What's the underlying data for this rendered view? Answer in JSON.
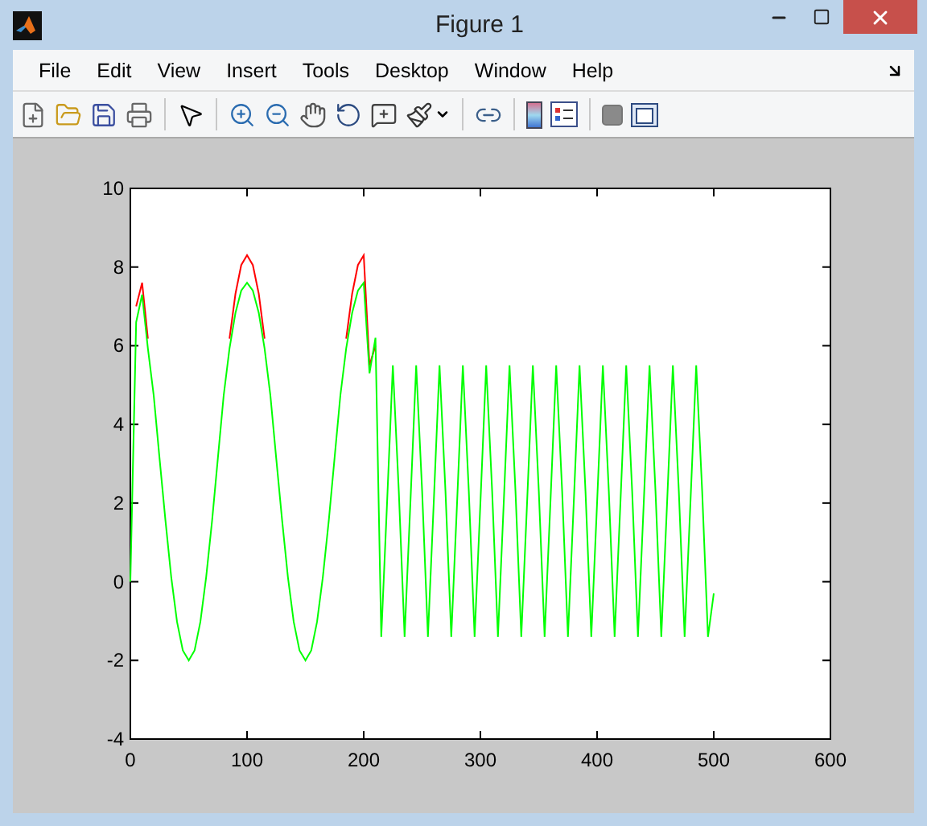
{
  "window": {
    "title": "Figure 1"
  },
  "menu": [
    "File",
    "Edit",
    "View",
    "Insert",
    "Tools",
    "Desktop",
    "Window",
    "Help"
  ],
  "axes": {
    "chart_data": {
      "type": "line",
      "xlim": [
        0,
        600
      ],
      "ylim": [
        -4,
        10
      ],
      "xticks": [
        0,
        100,
        200,
        300,
        400,
        500,
        600
      ],
      "yticks": [
        -4,
        -2,
        0,
        2,
        4,
        6,
        8,
        10
      ],
      "x": [
        0,
        5,
        10,
        15,
        20,
        25,
        30,
        35,
        40,
        45,
        50,
        55,
        60,
        65,
        70,
        75,
        80,
        85,
        90,
        95,
        100,
        105,
        110,
        115,
        120,
        125,
        130,
        135,
        140,
        145,
        150,
        155,
        160,
        165,
        170,
        175,
        180,
        185,
        190,
        195,
        200,
        205,
        210,
        215,
        220,
        225,
        230,
        235,
        240,
        245,
        250,
        255,
        260,
        265,
        270,
        275,
        280,
        285,
        290,
        295,
        300,
        305,
        310,
        315,
        320,
        325,
        330,
        335,
        340,
        345,
        350,
        355,
        360,
        365,
        370,
        375,
        380,
        385,
        390,
        395,
        400,
        405,
        410,
        415,
        420,
        425,
        430,
        435,
        440,
        445,
        450,
        455,
        460,
        465,
        470,
        475,
        480,
        485,
        490,
        495,
        500
      ],
      "series": [
        {
          "color": "#ff0000",
          "values": [
            null,
            7.0,
            7.6,
            6.18,
            null,
            null,
            null,
            null,
            null,
            null,
            null,
            null,
            null,
            null,
            null,
            null,
            null,
            6.18,
            7.32,
            8.05,
            8.3,
            8.05,
            7.32,
            6.18,
            null,
            null,
            null,
            null,
            null,
            null,
            null,
            null,
            null,
            null,
            null,
            null,
            null,
            6.18,
            7.32,
            8.05,
            8.3,
            5.5,
            6.0,
            null,
            null,
            null,
            null,
            null,
            null,
            null,
            null,
            null,
            null,
            null,
            null,
            null,
            null,
            null,
            null,
            null,
            null,
            null,
            null,
            null,
            null,
            null,
            null,
            null,
            null,
            null,
            null,
            null,
            null,
            null,
            null,
            null,
            null,
            null,
            null,
            null,
            null,
            null,
            null,
            null,
            null,
            null,
            null,
            null,
            null,
            null,
            null,
            null,
            null,
            null,
            null,
            null,
            null,
            null,
            null,
            null,
            null
          ]
        },
        {
          "color": "#00ff00",
          "values": [
            0,
            6.6,
            7.3,
            5.93,
            4.74,
            3.15,
            1.56,
            0.12,
            -1.02,
            -1.75,
            -2.0,
            -1.75,
            -1.02,
            0.12,
            1.56,
            3.15,
            4.74,
            5.93,
            6.83,
            7.4,
            7.6,
            7.4,
            6.83,
            5.93,
            4.74,
            3.15,
            1.56,
            0.12,
            -1.02,
            -1.75,
            -2.0,
            -1.75,
            -1.02,
            0.12,
            1.56,
            3.15,
            4.74,
            5.93,
            6.83,
            7.4,
            7.6,
            5.3,
            6.2,
            -1.4,
            2.0,
            5.5,
            2.3,
            -1.4,
            2.0,
            5.5,
            2.3,
            -1.4,
            2.0,
            5.5,
            2.3,
            -1.4,
            2.0,
            5.5,
            2.3,
            -1.4,
            2.0,
            5.5,
            2.3,
            -1.4,
            2.0,
            5.5,
            2.3,
            -1.4,
            2.0,
            5.5,
            2.3,
            -1.4,
            2.0,
            5.5,
            2.3,
            -1.4,
            2.0,
            5.5,
            2.3,
            -1.4,
            2.0,
            5.5,
            2.3,
            -1.4,
            2.0,
            5.5,
            2.3,
            -1.4,
            2.0,
            5.5,
            2.3,
            -1.4,
            2.0,
            5.5,
            2.3,
            -1.4,
            2.0,
            5.5,
            2.3,
            -1.4,
            -0.3
          ]
        }
      ]
    }
  }
}
